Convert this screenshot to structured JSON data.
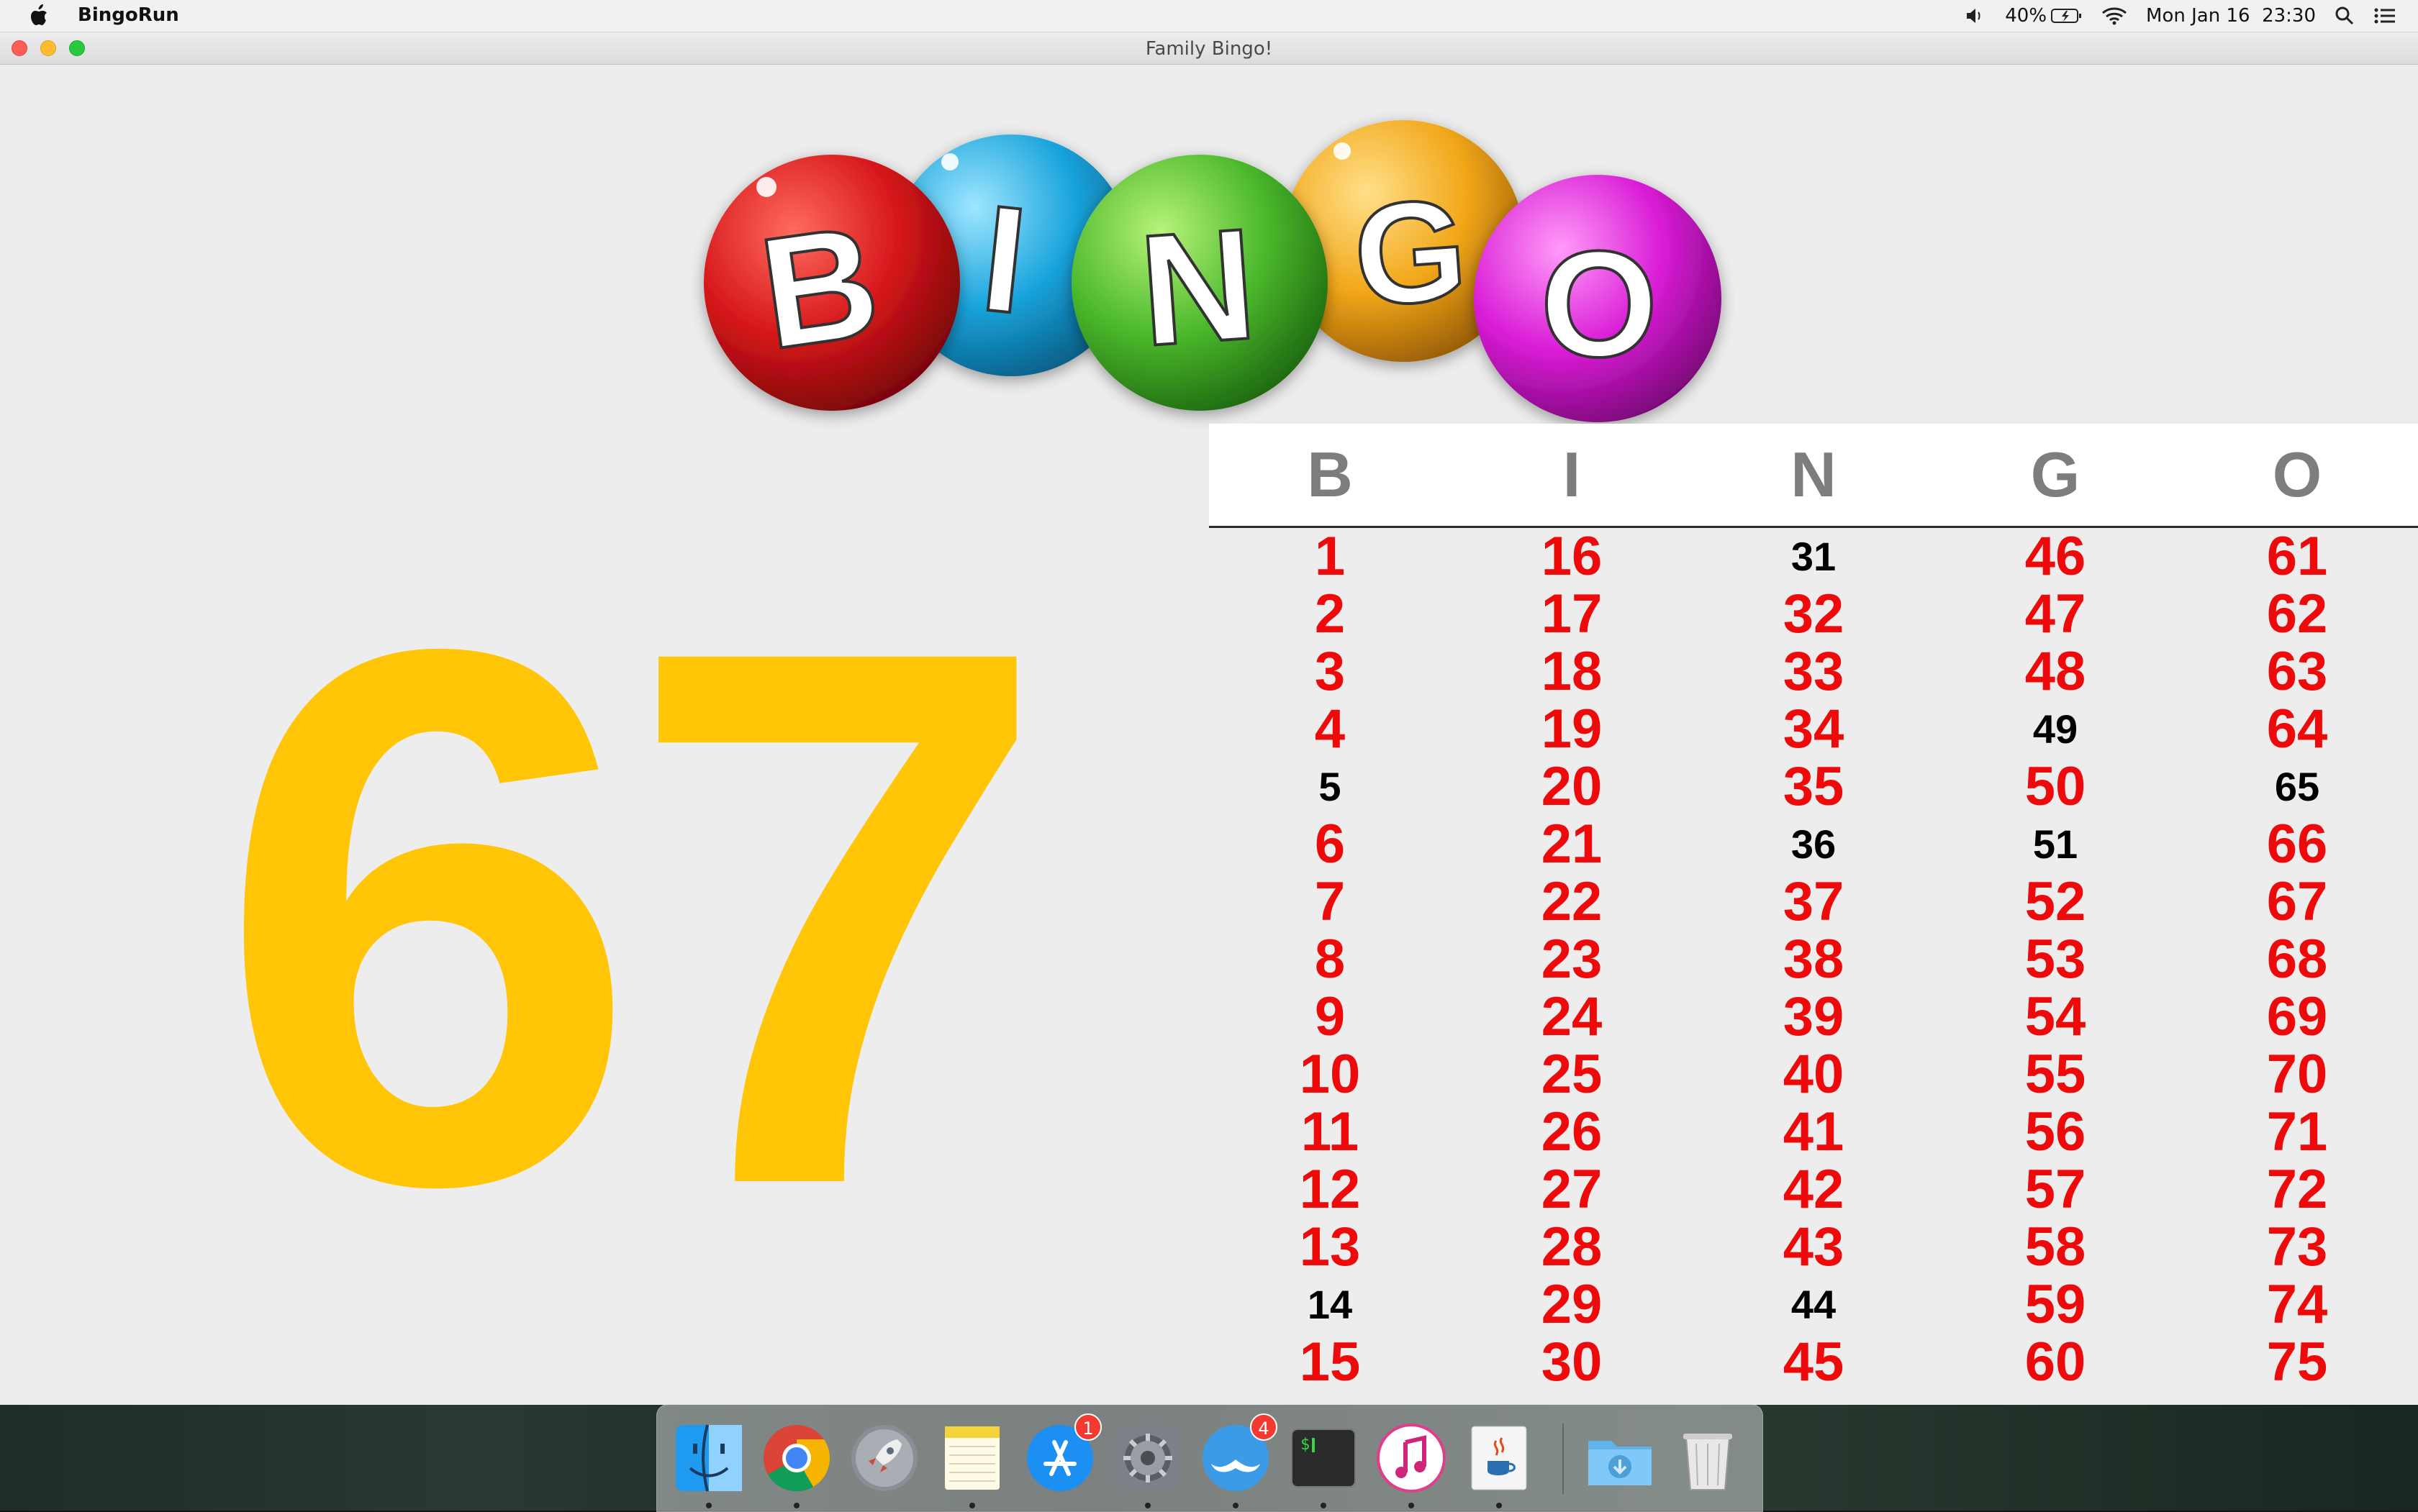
{
  "menubar": {
    "app_name": "BingoRun",
    "battery_percent": "40%",
    "clock": "Mon Jan 16  23:30",
    "icons": [
      "apple-icon",
      "volume-icon",
      "battery-icon",
      "wifi-icon",
      "spotlight-search-icon",
      "notification-center-icon"
    ]
  },
  "window": {
    "title": "Family Bingo!"
  },
  "logo": {
    "letters": [
      "B",
      "I",
      "N",
      "G",
      "O"
    ],
    "colors": [
      "#d6161a",
      "#19a4dc",
      "#4ab82b",
      "#f2a719",
      "#d91cd6"
    ]
  },
  "current_number": "67",
  "board": {
    "headers": [
      "B",
      "I",
      "N",
      "G",
      "O"
    ],
    "called_color": "#ee0a0a",
    "uncalled_color": "#000000",
    "columns": [
      {
        "cells": [
          {
            "n": "1",
            "called": true
          },
          {
            "n": "2",
            "called": true
          },
          {
            "n": "3",
            "called": true
          },
          {
            "n": "4",
            "called": true
          },
          {
            "n": "5",
            "called": false
          },
          {
            "n": "6",
            "called": true
          },
          {
            "n": "7",
            "called": true
          },
          {
            "n": "8",
            "called": true
          },
          {
            "n": "9",
            "called": true
          },
          {
            "n": "10",
            "called": true
          },
          {
            "n": "11",
            "called": true
          },
          {
            "n": "12",
            "called": true
          },
          {
            "n": "13",
            "called": true
          },
          {
            "n": "14",
            "called": false
          },
          {
            "n": "15",
            "called": true
          }
        ]
      },
      {
        "cells": [
          {
            "n": "16",
            "called": true
          },
          {
            "n": "17",
            "called": true
          },
          {
            "n": "18",
            "called": true
          },
          {
            "n": "19",
            "called": true
          },
          {
            "n": "20",
            "called": true
          },
          {
            "n": "21",
            "called": true
          },
          {
            "n": "22",
            "called": true
          },
          {
            "n": "23",
            "called": true
          },
          {
            "n": "24",
            "called": true
          },
          {
            "n": "25",
            "called": true
          },
          {
            "n": "26",
            "called": true
          },
          {
            "n": "27",
            "called": true
          },
          {
            "n": "28",
            "called": true
          },
          {
            "n": "29",
            "called": true
          },
          {
            "n": "30",
            "called": true
          }
        ]
      },
      {
        "cells": [
          {
            "n": "31",
            "called": false
          },
          {
            "n": "32",
            "called": true
          },
          {
            "n": "33",
            "called": true
          },
          {
            "n": "34",
            "called": true
          },
          {
            "n": "35",
            "called": true
          },
          {
            "n": "36",
            "called": false
          },
          {
            "n": "37",
            "called": true
          },
          {
            "n": "38",
            "called": true
          },
          {
            "n": "39",
            "called": true
          },
          {
            "n": "40",
            "called": true
          },
          {
            "n": "41",
            "called": true
          },
          {
            "n": "42",
            "called": true
          },
          {
            "n": "43",
            "called": true
          },
          {
            "n": "44",
            "called": false
          },
          {
            "n": "45",
            "called": true
          }
        ]
      },
      {
        "cells": [
          {
            "n": "46",
            "called": true
          },
          {
            "n": "47",
            "called": true
          },
          {
            "n": "48",
            "called": true
          },
          {
            "n": "49",
            "called": false
          },
          {
            "n": "50",
            "called": true
          },
          {
            "n": "51",
            "called": false
          },
          {
            "n": "52",
            "called": true
          },
          {
            "n": "53",
            "called": true
          },
          {
            "n": "54",
            "called": true
          },
          {
            "n": "55",
            "called": true
          },
          {
            "n": "56",
            "called": true
          },
          {
            "n": "57",
            "called": true
          },
          {
            "n": "58",
            "called": true
          },
          {
            "n": "59",
            "called": true
          },
          {
            "n": "60",
            "called": true
          }
        ]
      },
      {
        "cells": [
          {
            "n": "61",
            "called": true
          },
          {
            "n": "62",
            "called": true
          },
          {
            "n": "63",
            "called": true
          },
          {
            "n": "64",
            "called": true
          },
          {
            "n": "65",
            "called": false
          },
          {
            "n": "66",
            "called": true
          },
          {
            "n": "67",
            "called": true
          },
          {
            "n": "68",
            "called": true
          },
          {
            "n": "69",
            "called": true
          },
          {
            "n": "70",
            "called": true
          },
          {
            "n": "71",
            "called": true
          },
          {
            "n": "72",
            "called": true
          },
          {
            "n": "73",
            "called": true
          },
          {
            "n": "74",
            "called": true
          },
          {
            "n": "75",
            "called": true
          }
        ]
      }
    ]
  },
  "dock": {
    "items": [
      {
        "name": "finder",
        "icon": "finder-icon",
        "badge": ""
      },
      {
        "name": "chrome",
        "icon": "chrome-icon",
        "badge": ""
      },
      {
        "name": "launchpad",
        "icon": "launchpad-rocket-icon",
        "badge": ""
      },
      {
        "name": "notes",
        "icon": "notes-icon",
        "badge": ""
      },
      {
        "name": "app-store",
        "icon": "app-store-icon",
        "badge": "1"
      },
      {
        "name": "system-preferences",
        "icon": "gear-icon",
        "badge": ""
      },
      {
        "name": "mustache-app",
        "icon": "mustache-icon",
        "badge": "4"
      },
      {
        "name": "terminal",
        "icon": "terminal-icon",
        "badge": ""
      },
      {
        "name": "itunes",
        "icon": "music-note-icon",
        "badge": ""
      },
      {
        "name": "java",
        "icon": "java-cup-icon",
        "badge": ""
      },
      {
        "name": "downloads",
        "icon": "downloads-folder-icon",
        "badge": ""
      },
      {
        "name": "trash",
        "icon": "trash-icon",
        "badge": ""
      }
    ]
  }
}
